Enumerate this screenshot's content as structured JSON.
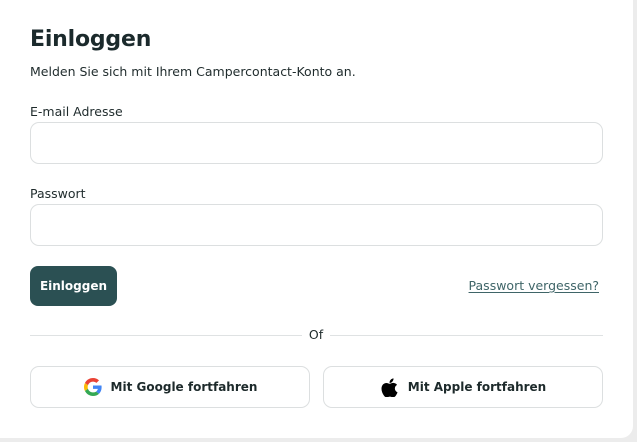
{
  "login": {
    "title": "Einloggen",
    "subtitle": "Melden Sie sich mit Ihrem Campercontact-Konto an.",
    "email_label": "E-mail Adresse",
    "email_value": "",
    "password_label": "Passwort",
    "password_value": "",
    "submit_label": "Einloggen",
    "forgot_label": "Passwort vergessen?",
    "divider_label": "Of",
    "google_label": "Mit Google fortfahren",
    "apple_label": "Mit Apple fortfahren"
  },
  "icons": {
    "google": "google-icon",
    "apple": "apple-icon"
  },
  "colors": {
    "primary": "#2b5053",
    "link": "#3f6568",
    "border": "#dcdfe0"
  }
}
